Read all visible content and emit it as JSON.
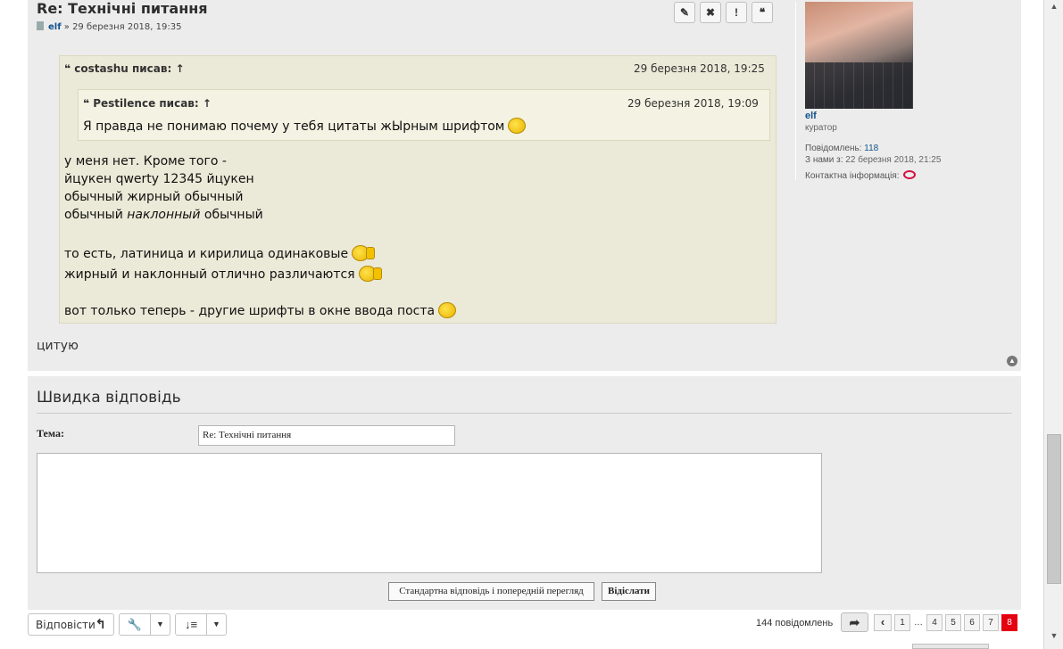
{
  "post": {
    "title": "Re: Технічні питання",
    "author": "elf",
    "meta_sep": "»",
    "date": "29 березня 2018, 19:35",
    "buttons": [
      "edit-icon",
      "delete-icon",
      "report-icon",
      "quote-icon"
    ],
    "quote_outer": {
      "author_line": "costashu писав: ↑",
      "date": "29 березня 2018, 19:25",
      "inner": {
        "author_line": "Pestilence писав: ↑",
        "date": "29 березня 2018, 19:09",
        "text": "Я правда не понимаю почему у тебя цитаты жЫрным шрифтом"
      },
      "lines": [
        "у меня нет. Кроме того -",
        "йцукен qwerty 12345 йцукен",
        "обычный жирный обычный",
        "то есть, латиница и кирилица одинаковые",
        "жирный и наклонный отлично различаются",
        "вот только теперь - другие шрифты в окне ввода поста"
      ],
      "italic_line": {
        "before": "обычный ",
        "italic": "наклонный",
        "after": " обычный"
      }
    },
    "body": "цитую"
  },
  "profile": {
    "name": "elf",
    "rank": "куратор",
    "posts_label": "Повідомлень:",
    "posts": "118",
    "joined_label": "З нами з:",
    "joined": "22 березня 2018, 21:25",
    "contact_label": "Контактна інформація:"
  },
  "quick_reply": {
    "title": "Швидка  відповідь",
    "subject_label": "Тема:",
    "subject_value": "Re:  Технічні питання",
    "preview_button": "Стандартна відповідь і попередній перегляд",
    "send_button": "Відіслати"
  },
  "action_bar": {
    "reply_label": "Відповісти",
    "post_count": "144 повідомлень",
    "pages": [
      "1",
      "…",
      "4",
      "5",
      "6",
      "7",
      "8"
    ],
    "current_page": "8"
  },
  "colors": {
    "link": "#105289",
    "quote_bg": "#ebe9d7",
    "current_page": "#e5000f"
  }
}
